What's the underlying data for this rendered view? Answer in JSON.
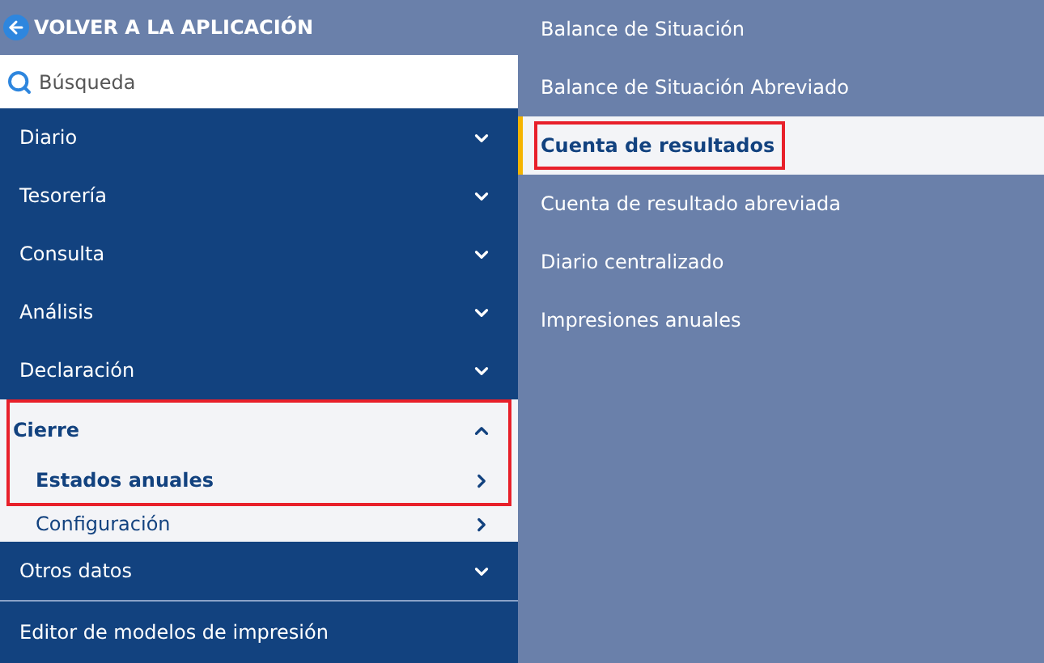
{
  "back_link": {
    "label": "VOLVER A LA APLICACIÓN"
  },
  "search": {
    "placeholder": "Búsqueda"
  },
  "menu": [
    {
      "label": "Diario",
      "expanded": false
    },
    {
      "label": "Tesorería",
      "expanded": false
    },
    {
      "label": "Consulta",
      "expanded": false
    },
    {
      "label": "Análisis",
      "expanded": false
    },
    {
      "label": "Declaración",
      "expanded": false
    },
    {
      "label": "Cierre",
      "expanded": true,
      "highlighted": true,
      "children": [
        {
          "label": "Estados anuales",
          "selected": true
        },
        {
          "label": "Configuración",
          "selected": false
        }
      ]
    },
    {
      "label": "Otros datos",
      "expanded": false
    },
    {
      "label": "Editor de modelos de impresión",
      "kind": "link"
    }
  ],
  "submenu": [
    {
      "label": "Balance de Situación",
      "selected": false,
      "highlighted": false
    },
    {
      "label": "Balance de Situación Abreviado",
      "selected": false,
      "highlighted": false
    },
    {
      "label": "Cuenta de resultados",
      "selected": true,
      "highlighted": true
    },
    {
      "label": "Cuenta de resultado abreviada",
      "selected": false,
      "highlighted": false
    },
    {
      "label": "Diario centralizado",
      "selected": false,
      "highlighted": false
    },
    {
      "label": "Impresiones anuales",
      "selected": false,
      "highlighted": false
    }
  ]
}
